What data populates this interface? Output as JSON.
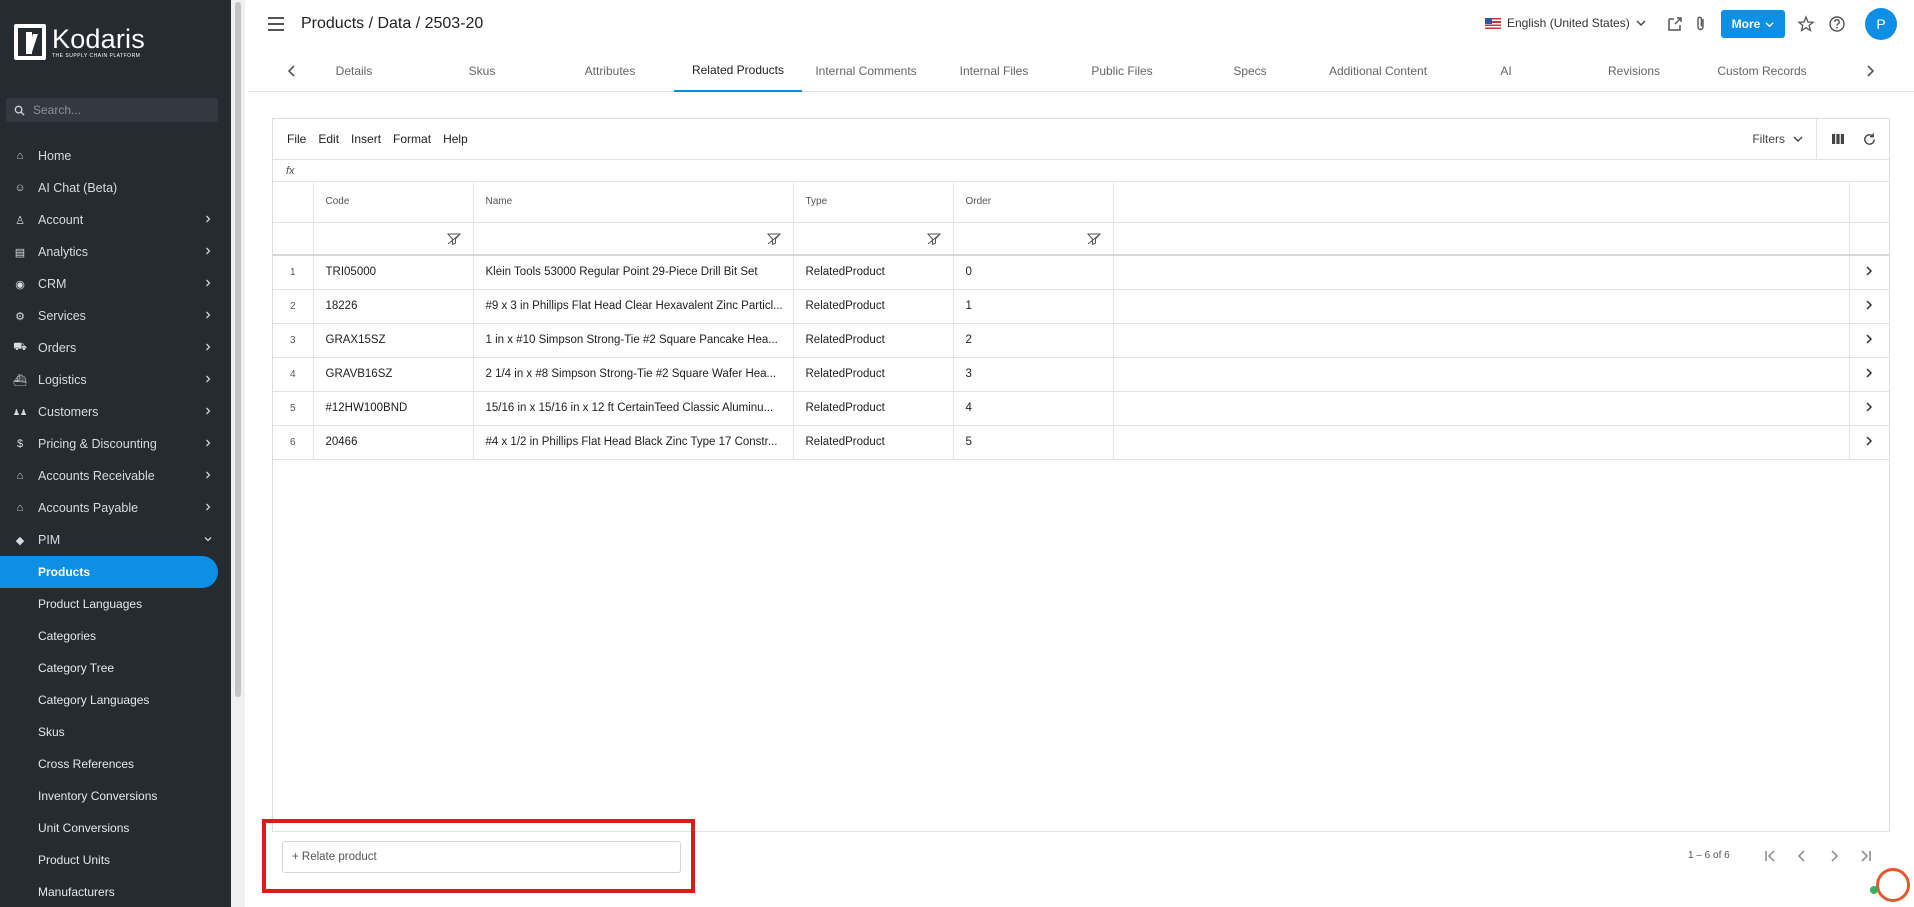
{
  "brand": {
    "name": "Kodaris",
    "tagline": "THE SUPPLY CHAIN PLATFORM",
    "accent": "#0d8fe6"
  },
  "sidebar": {
    "search_placeholder": "Search...",
    "items": [
      {
        "label": "Home",
        "icon": "home-icon",
        "chevron": false
      },
      {
        "label": "AI Chat (Beta)",
        "icon": "robot-icon",
        "chevron": false
      },
      {
        "label": "Account",
        "icon": "person-icon",
        "chevron": true
      },
      {
        "label": "Analytics",
        "icon": "chart-icon",
        "chevron": true
      },
      {
        "label": "CRM",
        "icon": "contact-icon",
        "chevron": true
      },
      {
        "label": "Services",
        "icon": "services-icon",
        "chevron": true
      },
      {
        "label": "Orders",
        "icon": "truck-icon",
        "chevron": true
      },
      {
        "label": "Logistics",
        "icon": "ship-icon",
        "chevron": true
      },
      {
        "label": "Customers",
        "icon": "people-icon",
        "chevron": true
      },
      {
        "label": "Pricing & Discounting",
        "icon": "dollar-icon",
        "chevron": true
      },
      {
        "label": "Accounts Receivable",
        "icon": "bank-icon",
        "chevron": true
      },
      {
        "label": "Accounts Payable",
        "icon": "bank-icon",
        "chevron": true
      },
      {
        "label": "PIM",
        "icon": "tag-icon",
        "chevron": true
      }
    ],
    "pim_children": [
      "Products",
      "Product Languages",
      "Categories",
      "Category Tree",
      "Category Languages",
      "Skus",
      "Cross References",
      "Inventory Conversions",
      "Unit Conversions",
      "Product Units",
      "Manufacturers"
    ],
    "active_child": "Products"
  },
  "header": {
    "breadcrumb": "Products / Data / 2503-20",
    "language": "English (United States)",
    "more_label": "More",
    "avatar_initial": "P"
  },
  "tabs": [
    "Details",
    "Skus",
    "Attributes",
    "Related Products",
    "Internal Comments",
    "Internal Files",
    "Public Files",
    "Specs",
    "Additional Content",
    "AI",
    "Revisions",
    "Custom Records"
  ],
  "active_tab": "Related Products",
  "grid": {
    "menu": [
      "File",
      "Edit",
      "Insert",
      "Format",
      "Help"
    ],
    "filters_label": "Filters",
    "fx_label": "fx",
    "columns": [
      "Code",
      "Name",
      "Type",
      "Order"
    ],
    "rows": [
      {
        "n": "1",
        "code": "TRI05000",
        "name": "Klein Tools 53000 Regular Point 29-Piece Drill Bit Set",
        "type": "RelatedProduct",
        "order": "0"
      },
      {
        "n": "2",
        "code": "18226",
        "name": "#9 x 3 in Phillips Flat Head Clear Hexavalent Zinc Particl...",
        "type": "RelatedProduct",
        "order": "1"
      },
      {
        "n": "3",
        "code": "GRAX15SZ",
        "name": "1 in x #10 Simpson Strong-Tie #2 Square Pancake Hea...",
        "type": "RelatedProduct",
        "order": "2"
      },
      {
        "n": "4",
        "code": "GRAVB16SZ",
        "name": "2 1/4 in x #8 Simpson Strong-Tie #2 Square Wafer Hea...",
        "type": "RelatedProduct",
        "order": "3"
      },
      {
        "n": "5",
        "code": "#12HW100BND",
        "name": "15/16 in x 15/16 in x 12 ft CertainTeed Classic Aluminu...",
        "type": "RelatedProduct",
        "order": "4"
      },
      {
        "n": "6",
        "code": "20466",
        "name": "#4 x 1/2 in Phillips Flat Head Black Zinc Type 17 Constr...",
        "type": "RelatedProduct",
        "order": "5"
      }
    ]
  },
  "footer": {
    "relate_button": "+ Relate product",
    "pager": "1 – 6 of 6"
  }
}
